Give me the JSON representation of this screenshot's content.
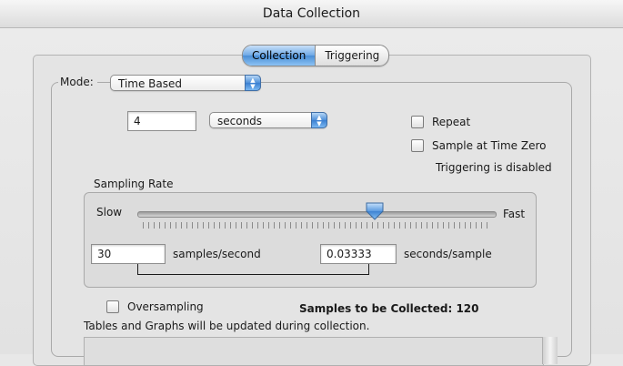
{
  "window": {
    "title": "Data Collection"
  },
  "tabs": [
    {
      "label": "Collection",
      "active": true
    },
    {
      "label": "Triggering",
      "active": false
    }
  ],
  "mode": {
    "label": "Mode:",
    "value": "Time Based"
  },
  "duration": {
    "value": "4",
    "unit": "seconds"
  },
  "options": {
    "repeat_label": "Repeat",
    "sample_at_zero_label": "Sample at Time Zero",
    "triggering_status": "Triggering is disabled"
  },
  "sampling_rate": {
    "label": "Sampling Rate",
    "slow_label": "Slow",
    "fast_label": "Fast",
    "slider_fraction": 0.66,
    "samples_per_second": "30",
    "samples_per_second_unit": "samples/second",
    "seconds_per_sample": "0.03333",
    "seconds_per_sample_unit": "seconds/sample"
  },
  "oversampling_label": "Oversampling",
  "samples_to_collect": "Samples to be Collected:  120",
  "update_note": "Tables and Graphs will be updated during collection.",
  "colors": {
    "accent": "#4a8ed6",
    "window_bg": "#e4e4e4"
  }
}
